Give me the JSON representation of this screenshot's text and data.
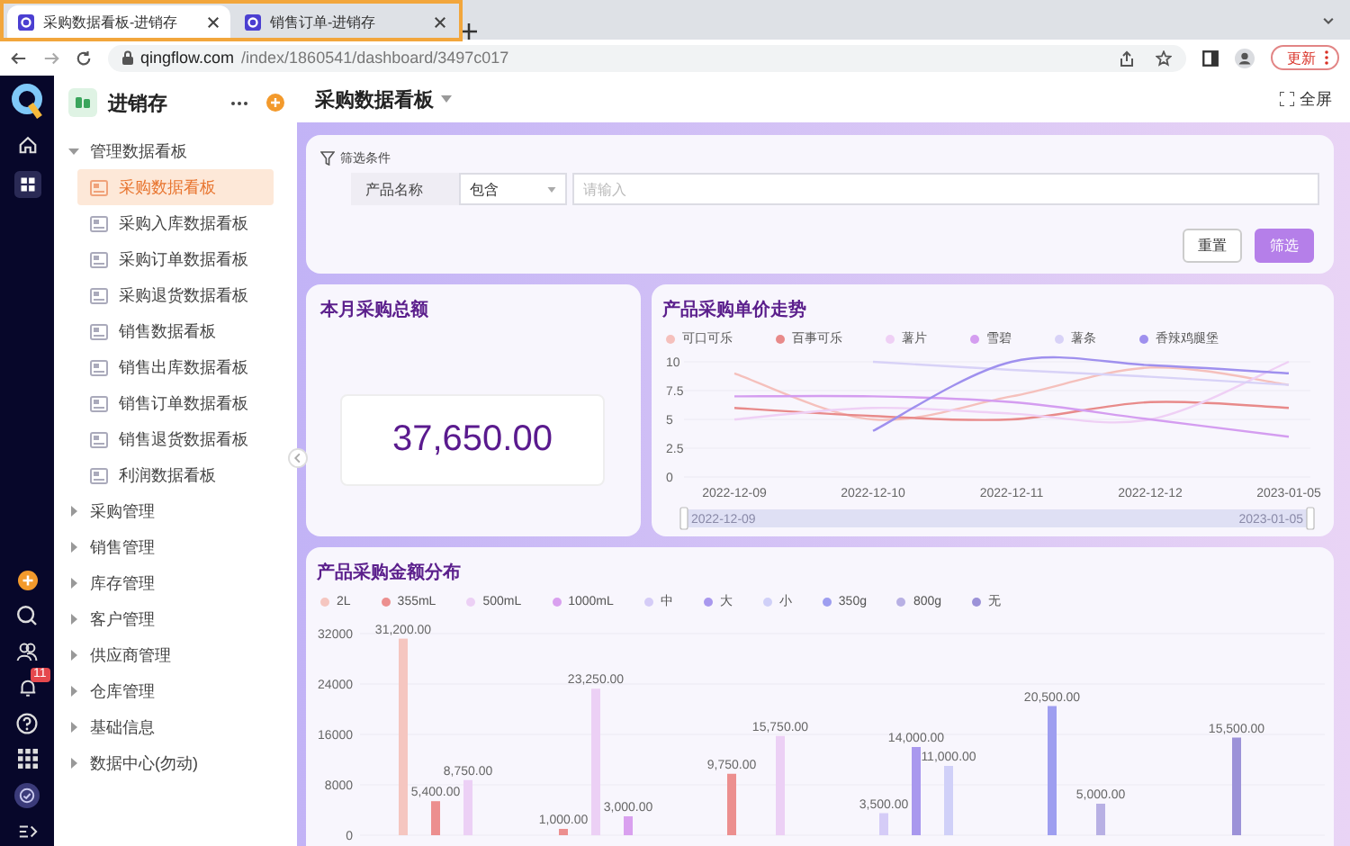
{
  "browser": {
    "tabs": [
      {
        "title": "采购数据看板-进销存",
        "selected": true
      },
      {
        "title": "销售订单-进销存",
        "selected": false
      }
    ],
    "url_host": "qingflow.com",
    "url_path": "/index/1860541/dashboard/3497c017",
    "update_button": "更新"
  },
  "rail": {
    "notification_badge": "11"
  },
  "sidebar": {
    "app_name": "进销存",
    "groups": [
      {
        "label": "管理数据看板",
        "expanded": true,
        "children": [
          {
            "label": "采购数据看板",
            "selected": true
          },
          {
            "label": "采购入库数据看板",
            "selected": false
          },
          {
            "label": "采购订单数据看板",
            "selected": false
          },
          {
            "label": "采购退货数据看板",
            "selected": false
          },
          {
            "label": "销售数据看板",
            "selected": false
          },
          {
            "label": "销售出库数据看板",
            "selected": false
          },
          {
            "label": "销售订单数据看板",
            "selected": false
          },
          {
            "label": "销售退货数据看板",
            "selected": false
          },
          {
            "label": "利润数据看板",
            "selected": false
          }
        ]
      },
      {
        "label": "采购管理",
        "expanded": false
      },
      {
        "label": "销售管理",
        "expanded": false
      },
      {
        "label": "库存管理",
        "expanded": false
      },
      {
        "label": "客户管理",
        "expanded": false
      },
      {
        "label": "供应商管理",
        "expanded": false
      },
      {
        "label": "仓库管理",
        "expanded": false
      },
      {
        "label": "基础信息",
        "expanded": false
      },
      {
        "label": "数据中心(勿动)",
        "expanded": false
      }
    ]
  },
  "page": {
    "title": "采购数据看板",
    "fullscreen_button": "全屏"
  },
  "filter": {
    "title": "筛选条件",
    "field_label": "产品名称",
    "operator": "包含",
    "placeholder": "请输入",
    "reset_button": "重置",
    "filter_button": "筛选"
  },
  "kpi": {
    "title": "本月采购总额",
    "value": "37,650.00"
  },
  "line_chart": {
    "range": {
      "start": "2022-12-09",
      "end": "2023-01-05"
    },
    "chart_data": {
      "type": "line",
      "title": "产品采购单价走势",
      "x": [
        "2022-12-09",
        "2022-12-10",
        "2022-12-11",
        "2022-12-12",
        "2023-01-05"
      ],
      "ylim": [
        0,
        10
      ],
      "yticks": [
        0,
        2.5,
        5,
        7.5,
        10
      ],
      "grid": true,
      "series": [
        {
          "name": "可口可乐",
          "color": "#f5c0bc",
          "values": [
            9,
            5,
            7,
            9.5,
            8
          ]
        },
        {
          "name": "百事可乐",
          "color": "#e88a8a",
          "values": [
            6,
            5.3,
            5,
            6.5,
            6
          ]
        },
        {
          "name": "薯片",
          "color": "#efd0f5",
          "values": [
            5,
            6,
            5.5,
            5,
            10
          ]
        },
        {
          "name": "雪碧",
          "color": "#d49df0",
          "values": [
            7,
            7,
            6.5,
            5,
            3.5
          ]
        },
        {
          "name": "薯条",
          "color": "#d8d2f7",
          "values": [
            null,
            10,
            9.3,
            8.7,
            8
          ]
        },
        {
          "name": "香辣鸡腿堡",
          "color": "#9f90ee",
          "values": [
            null,
            4,
            10,
            9.7,
            9
          ]
        }
      ]
    }
  },
  "bar_chart": {
    "chart_data": {
      "type": "bar",
      "title": "产品采购金额分布",
      "ylim": [
        0,
        32000
      ],
      "yticks": [
        0,
        8000,
        16000,
        24000,
        32000
      ],
      "grid": true,
      "series": [
        {
          "name": "2L",
          "color": "#f5c6c0",
          "values": [
            31200,
            null,
            null,
            null,
            null,
            null
          ],
          "value_labels": [
            "31,200.00",
            null,
            null,
            null,
            null,
            null
          ]
        },
        {
          "name": "355mL",
          "color": "#ec8f8f",
          "values": [
            5400,
            1000,
            9750,
            null,
            null,
            null
          ],
          "value_labels": [
            "5,400.00",
            "1,000.00",
            "9,750.00",
            null,
            null,
            null
          ]
        },
        {
          "name": "500mL",
          "color": "#ecd0f5",
          "values": [
            8750,
            23250,
            15750,
            null,
            null,
            null
          ],
          "value_labels": [
            "8,750.00",
            "23,250.00",
            "15,750.00",
            null,
            null,
            null
          ]
        },
        {
          "name": "1000mL",
          "color": "#d9a0ef",
          "values": [
            null,
            3000,
            null,
            null,
            null,
            null
          ],
          "value_labels": [
            null,
            "3,000.00",
            null,
            null,
            null,
            null
          ]
        },
        {
          "name": "中",
          "color": "#d5ccf7",
          "values": [
            null,
            null,
            null,
            3500,
            null,
            null
          ],
          "value_labels": [
            null,
            null,
            null,
            "3,500.00",
            null,
            null
          ]
        },
        {
          "name": "大",
          "color": "#a998ee",
          "values": [
            null,
            null,
            null,
            14000,
            null,
            null
          ],
          "value_labels": [
            null,
            null,
            null,
            "14,000.00",
            null,
            null
          ]
        },
        {
          "name": "小",
          "color": "#d0d0f8",
          "values": [
            null,
            null,
            null,
            11000,
            null,
            null
          ],
          "value_labels": [
            null,
            null,
            null,
            "11,000.00",
            null,
            null
          ]
        },
        {
          "name": "350g",
          "color": "#9e9ef0",
          "values": [
            null,
            null,
            null,
            null,
            20500,
            null
          ],
          "value_labels": [
            null,
            null,
            null,
            null,
            "20,500.00",
            null
          ]
        },
        {
          "name": "800g",
          "color": "#b8b0e4",
          "values": [
            null,
            null,
            null,
            null,
            5000,
            null
          ],
          "value_labels": [
            null,
            null,
            null,
            null,
            "5,000.00",
            null
          ]
        },
        {
          "name": "无",
          "color": "#9c92d8",
          "values": [
            null,
            null,
            null,
            null,
            null,
            15500
          ],
          "value_labels": [
            null,
            null,
            null,
            null,
            null,
            "15,500.00"
          ]
        }
      ]
    }
  }
}
